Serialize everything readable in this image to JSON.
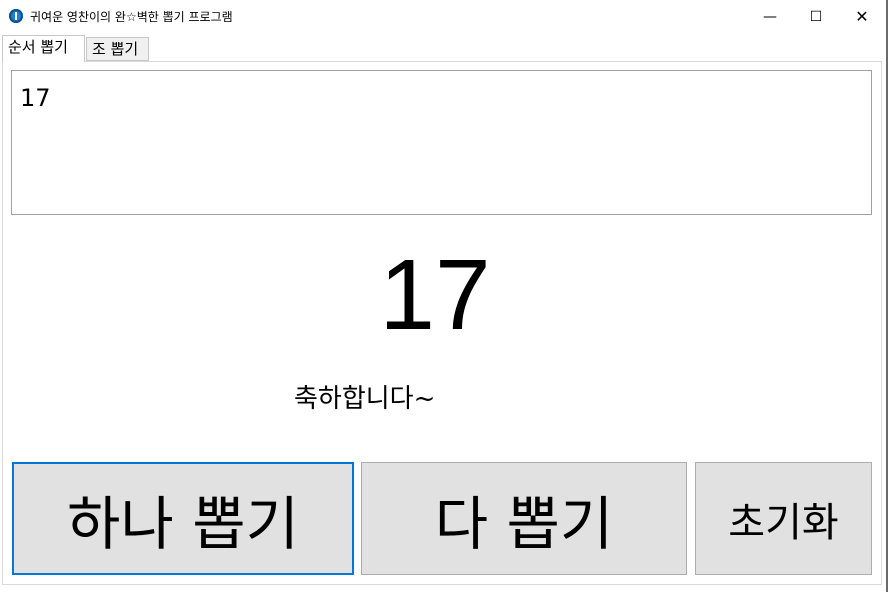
{
  "window": {
    "title": "귀여운 영찬이의 완☆벽한 뽑기 프로그램",
    "min_glyph": "—",
    "max_glyph": "☐",
    "close_glyph": "✕"
  },
  "tabs": [
    {
      "label": "순서 뽑기",
      "active": true
    },
    {
      "label": "조 뽑기",
      "active": false
    }
  ],
  "main": {
    "result_list": "17",
    "current_number": "17",
    "message": "축하합니다~"
  },
  "buttons": {
    "pick_one": "하나 뽑기",
    "pick_all": "다 뽑기",
    "reset": "초기화"
  },
  "colors": {
    "focus_border": "#0078d7",
    "button_bg": "#e1e1e1"
  }
}
